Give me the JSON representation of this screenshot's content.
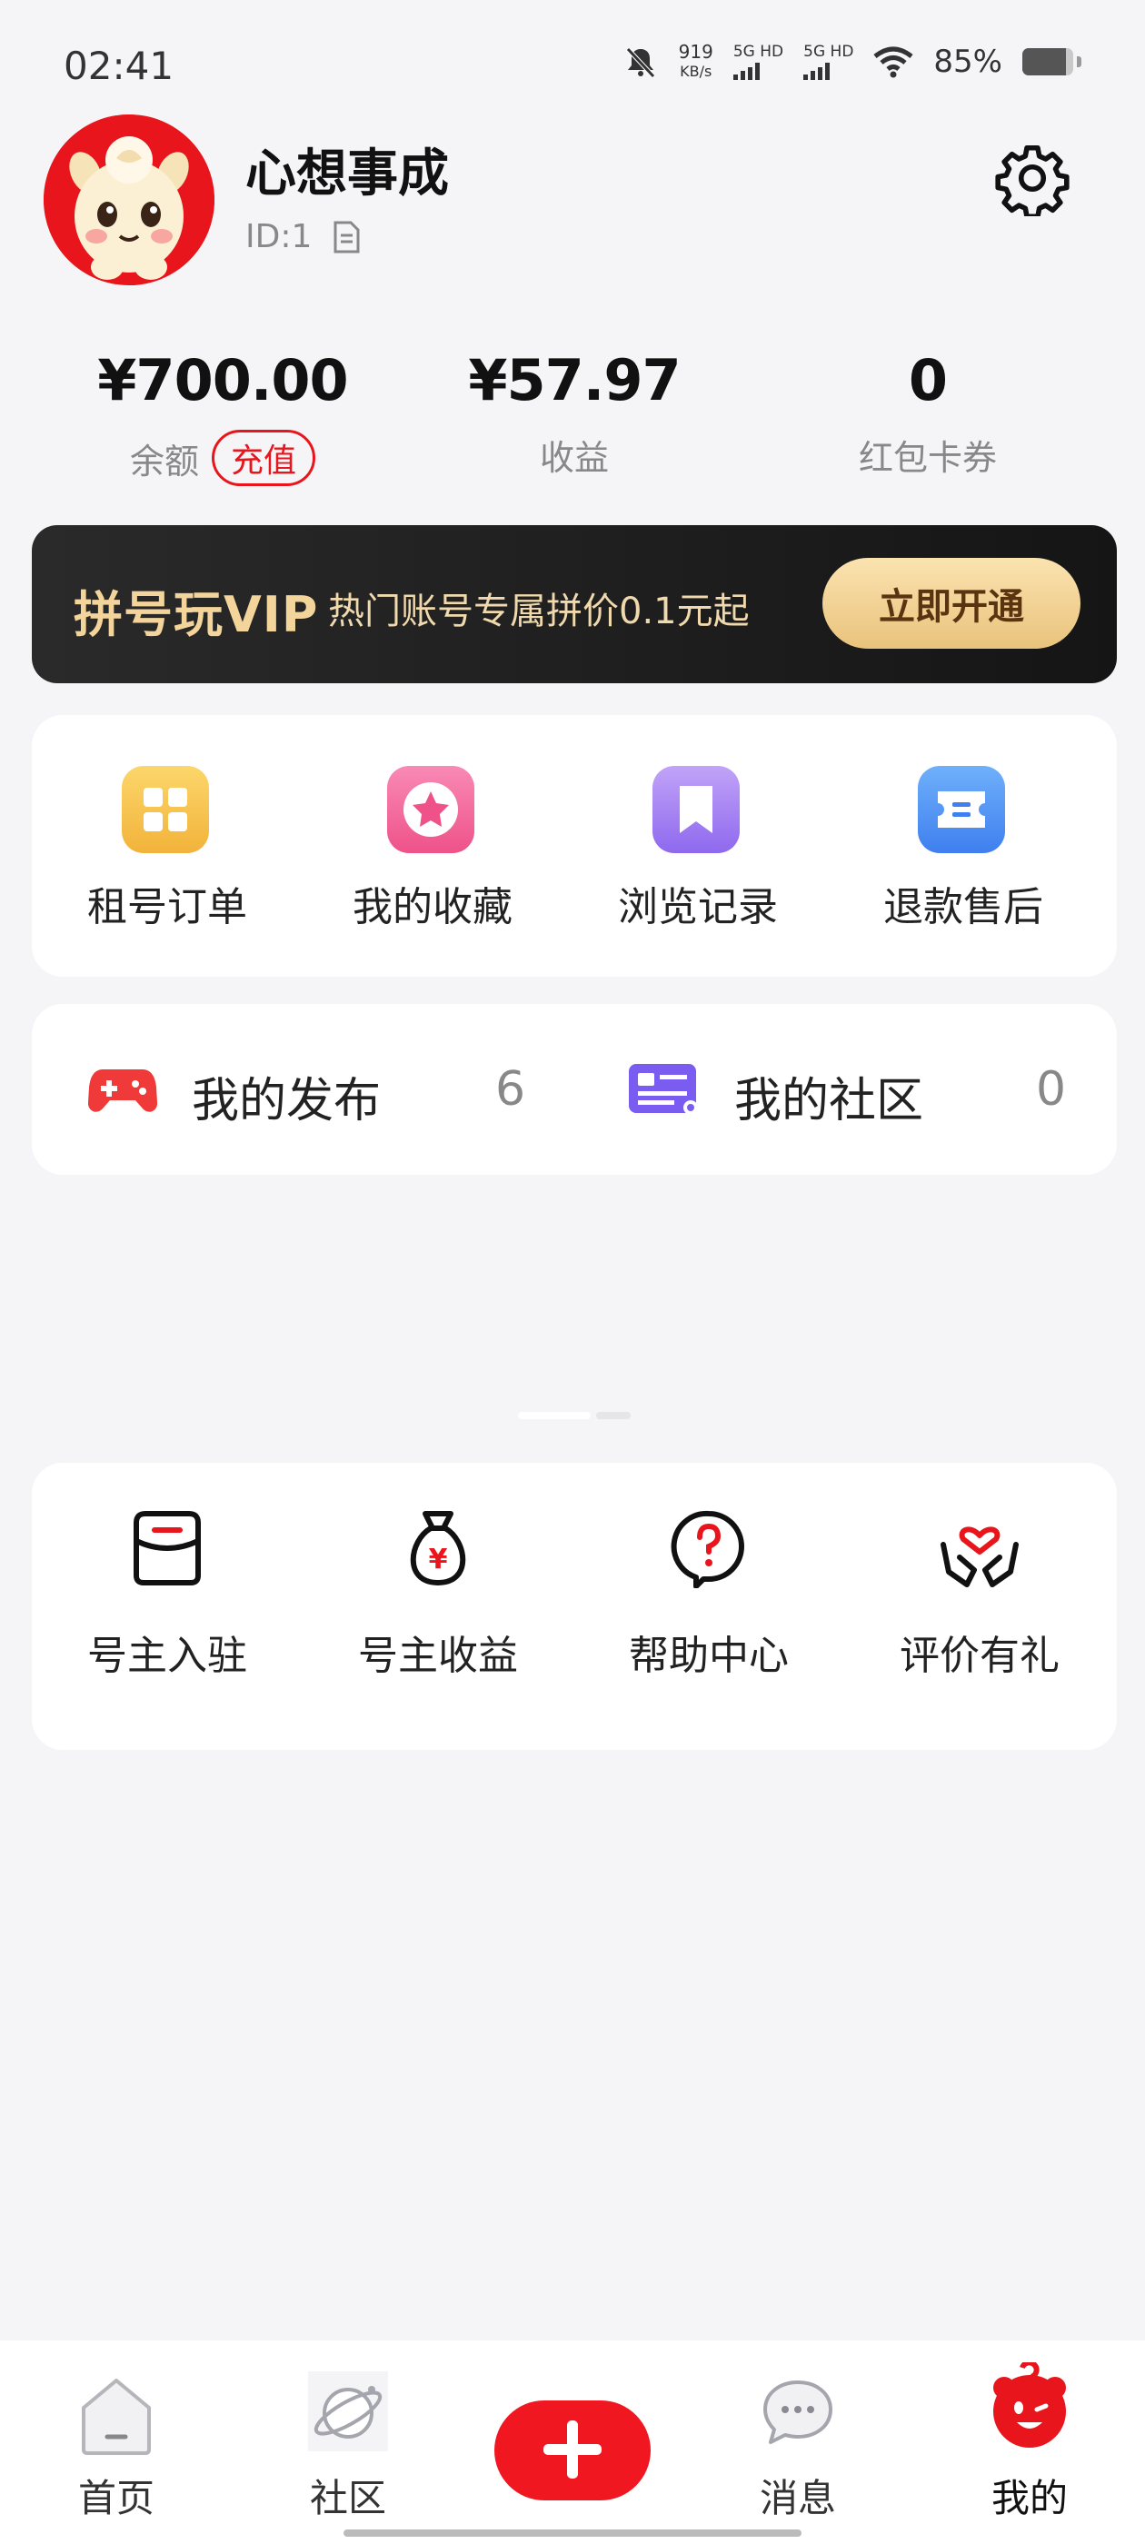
{
  "status_bar": {
    "time": "02:41",
    "net_speed_value": "919",
    "net_speed_unit": "KB/s",
    "sim1": "5G HD",
    "sim2": "5G HD",
    "battery_percent": "85%",
    "battery_level": 0.85,
    "icons": [
      "bell-muted-icon",
      "signal-icon",
      "wifi-icon",
      "battery-icon"
    ]
  },
  "profile": {
    "username": "心想事成",
    "user_id": "ID:1",
    "avatar_icon": "cartoon-horse-avatar",
    "settings_icon": "gear-icon"
  },
  "stats": [
    {
      "value": "¥700.00",
      "label": "余额",
      "action": "充值"
    },
    {
      "value": "¥57.97",
      "label": "收益"
    },
    {
      "value": "0",
      "label": "红包卡券"
    }
  ],
  "vip_banner": {
    "title": "拼号玩VIP",
    "description": "热门账号专属拼价0.1元起",
    "button": "立即开通"
  },
  "quick_menu": [
    {
      "label": "租号订单",
      "icon": "grid-icon",
      "color": "#f6c244"
    },
    {
      "label": "我的收藏",
      "icon": "star-icon",
      "color": "#f4679a"
    },
    {
      "label": "浏览记录",
      "icon": "bookmark-icon",
      "color": "#a07cf2"
    },
    {
      "label": "退款售后",
      "icon": "ticket-icon",
      "color": "#4d8ff5"
    }
  ],
  "publish_row": [
    {
      "label": "我的发布",
      "count": "6",
      "icon": "gamepad-icon"
    },
    {
      "label": "我的社区",
      "count": "0",
      "icon": "community-card-icon"
    }
  ],
  "services": [
    {
      "label": "号主入驻",
      "icon": "store-icon"
    },
    {
      "label": "号主收益",
      "icon": "money-bag-icon"
    },
    {
      "label": "帮助中心",
      "icon": "help-icon"
    },
    {
      "label": "评价有礼",
      "icon": "heart-hands-icon"
    }
  ],
  "bottom_nav": [
    {
      "label": "首页",
      "icon": "home-icon"
    },
    {
      "label": "社区",
      "icon": "planet-icon"
    },
    {
      "label": "",
      "icon": "plus-icon"
    },
    {
      "label": "消息",
      "icon": "chat-icon"
    },
    {
      "label": "我的",
      "icon": "mascot-icon",
      "active": true
    }
  ],
  "colors": {
    "accent": "#e8161c",
    "vip_gold": "#f3d49a",
    "background": "#f5f5f7"
  }
}
